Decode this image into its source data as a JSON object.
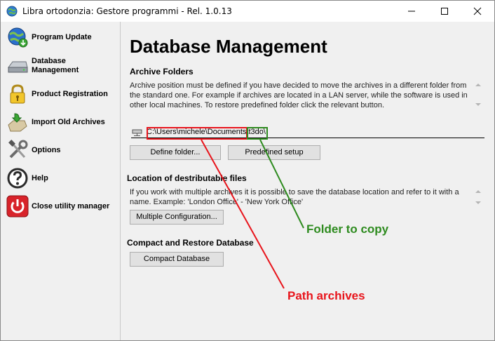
{
  "window": {
    "title": "Libra ortodonzia: Gestore programmi - Rel. 1.0.13"
  },
  "sidebar": {
    "items": [
      {
        "label": "Program Update",
        "icon": "globe-download-icon"
      },
      {
        "label": "Database Management",
        "icon": "drive-icon"
      },
      {
        "label": "Product Registration",
        "icon": "lock-icon"
      },
      {
        "label": "Import Old Archives",
        "icon": "import-icon"
      },
      {
        "label": "Options",
        "icon": "tools-icon"
      },
      {
        "label": "Help",
        "icon": "help-icon"
      },
      {
        "label": "Close utility manager",
        "icon": "power-icon"
      }
    ]
  },
  "main": {
    "title": "Database Management",
    "archive": {
      "heading": "Archive Folders",
      "description": "Archive position must be defined if you have decided to move the archives in a different folder from the standard one. For example if archives are located in a LAN server, while the software is used in other local machines. To restore predefined folder click the relevant button.",
      "path_base": "C:\\Users\\michele\\Documents\\",
      "path_folder": "t3do\\",
      "define_button": "Define folder...",
      "predefined_button": "Predefined setup"
    },
    "location": {
      "heading": "Location of destributable files",
      "description": "If you work with multiple archives it is possible to save the database location and refer to it with a name. Example: 'London Office' - 'New York Office'",
      "multiple_button": "Multiple Configuration..."
    },
    "compact": {
      "heading": "Compact and Restore Database",
      "compact_button": "Compact Database"
    }
  },
  "annotations": {
    "folder_label": "Folder to copy",
    "folder_color": "#2e8b1f",
    "path_label": "Path archives",
    "path_color": "#e8141b"
  }
}
